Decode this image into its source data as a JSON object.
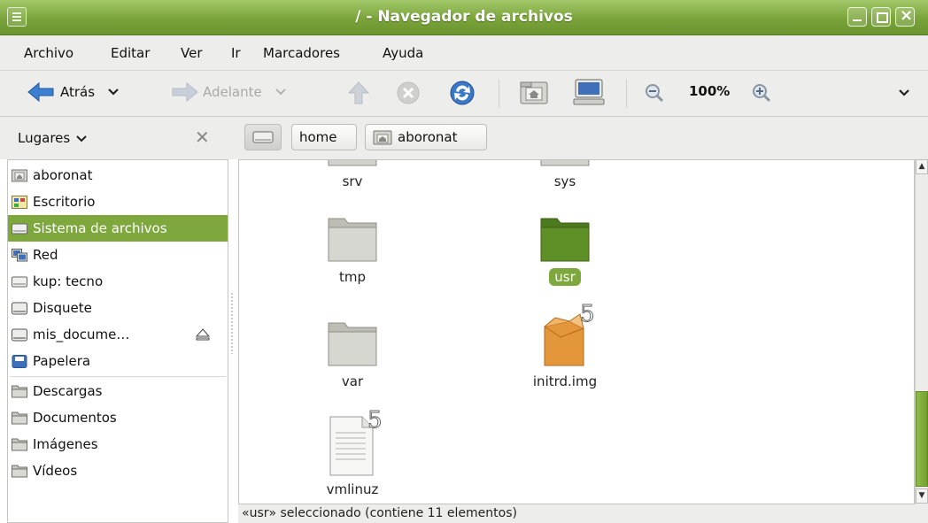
{
  "window": {
    "title": "/ - Navegador de archivos",
    "accent": "#7ea83d"
  },
  "menubar": {
    "items": [
      "Archivo",
      "Editar",
      "Ver",
      "Ir",
      "Marcadores",
      "Ayuda"
    ]
  },
  "toolbar": {
    "back_label": "Atrás",
    "forward_label": "Adelante",
    "zoom_level": "100%",
    "icons": [
      "arrow-left-icon",
      "chevron-down-icon",
      "arrow-right-icon",
      "arrow-up-icon",
      "stop-icon",
      "reload-icon",
      "home-icon",
      "computer-icon",
      "zoom-out-icon",
      "zoom-in-icon"
    ]
  },
  "location": {
    "places_label": "Lugares",
    "breadcrumbs": [
      "home",
      "aboronat"
    ]
  },
  "sidebar": {
    "items": [
      {
        "label": "aboronat",
        "icon": "home-folder-icon",
        "selected": false
      },
      {
        "label": "Escritorio",
        "icon": "desktop-icon",
        "selected": false
      },
      {
        "label": "Sistema de archivos",
        "icon": "drive-icon",
        "selected": true
      },
      {
        "label": "Red",
        "icon": "network-icon",
        "selected": false
      },
      {
        "label": "kup: tecno",
        "icon": "drive-icon",
        "selected": false
      },
      {
        "label": "Disquete",
        "icon": "floppy-icon",
        "selected": false
      },
      {
        "label": "mis_docume…",
        "icon": "drive-icon",
        "selected": false
      },
      {
        "label": "Papelera",
        "icon": "trash-icon",
        "selected": false
      }
    ],
    "bookmarks": [
      {
        "label": "Descargas",
        "icon": "folder-icon"
      },
      {
        "label": "Documentos",
        "icon": "folder-icon"
      },
      {
        "label": "Imágenes",
        "icon": "folder-icon"
      },
      {
        "label": "Vídeos",
        "icon": "folder-icon"
      }
    ]
  },
  "files": [
    {
      "name": "srv",
      "type": "folder"
    },
    {
      "name": "sys",
      "type": "folder"
    },
    {
      "name": "tmp",
      "type": "folder"
    },
    {
      "name": "usr",
      "type": "folder",
      "selected": true
    },
    {
      "name": "var",
      "type": "folder"
    },
    {
      "name": "initrd.img",
      "type": "package-link"
    },
    {
      "name": "vmlinuz",
      "type": "text-link"
    }
  ],
  "status": {
    "text": "«usr» seleccionado (contiene 11 elementos)"
  }
}
